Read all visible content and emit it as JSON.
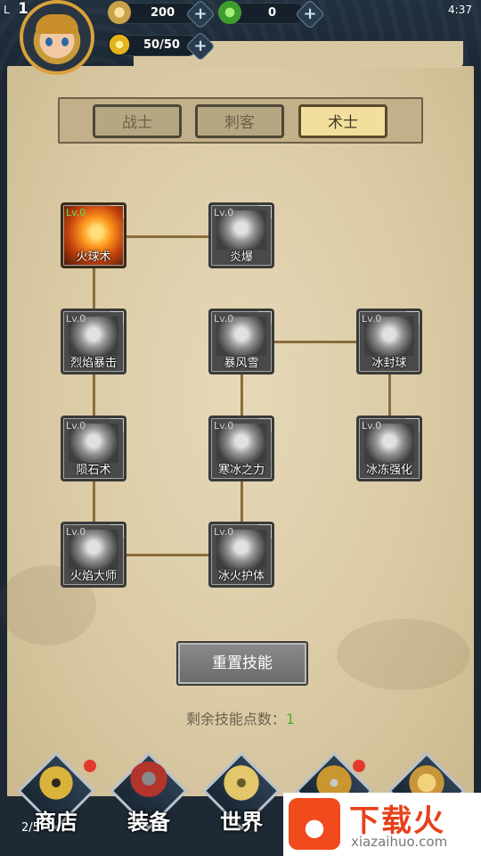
{
  "status_bar": {
    "left_level_text": "L",
    "time": "4:37"
  },
  "player": {
    "level": "1"
  },
  "resources": {
    "coins": "200",
    "jade": "0",
    "energy": "50/50"
  },
  "class_tabs": [
    {
      "label": "战士",
      "selected": false
    },
    {
      "label": "刺客",
      "selected": false
    },
    {
      "label": "术士",
      "selected": true
    }
  ],
  "skills": [
    {
      "name": "火球术",
      "level": "Lv.0",
      "unlocked": true
    },
    {
      "name": "炎爆",
      "level": "Lv.0",
      "unlocked": false
    },
    {
      "name": "烈焰暴击",
      "level": "Lv.0",
      "unlocked": false
    },
    {
      "name": "暴风雪",
      "level": "Lv.0",
      "unlocked": false
    },
    {
      "name": "冰封球",
      "level": "Lv.0",
      "unlocked": false
    },
    {
      "name": "陨石术",
      "level": "Lv.0",
      "unlocked": false
    },
    {
      "name": "寒冰之力",
      "level": "Lv.0",
      "unlocked": false
    },
    {
      "name": "冰冻强化",
      "level": "Lv.0",
      "unlocked": false
    },
    {
      "name": "火焰大师",
      "level": "Lv.0",
      "unlocked": false
    },
    {
      "name": "冰火护体",
      "level": "Lv.0",
      "unlocked": false
    }
  ],
  "reset_button": "重置技能",
  "remaining": {
    "label": "剩余技能点数：",
    "value": "1"
  },
  "bottom_nav": [
    {
      "label": "商店",
      "badge": true
    },
    {
      "label": "装备",
      "badge": false
    },
    {
      "label": "世界",
      "badge": false
    },
    {
      "label": "",
      "badge": true
    },
    {
      "label": "",
      "badge": false
    }
  ],
  "pager": "2/5",
  "watermark": {
    "cn": "下载火",
    "en": "xiazaihuo.com"
  },
  "colors": {
    "accent_green": "#4caf32",
    "tab_selected": "#f2df9e",
    "badge_red": "#e23b2e"
  }
}
